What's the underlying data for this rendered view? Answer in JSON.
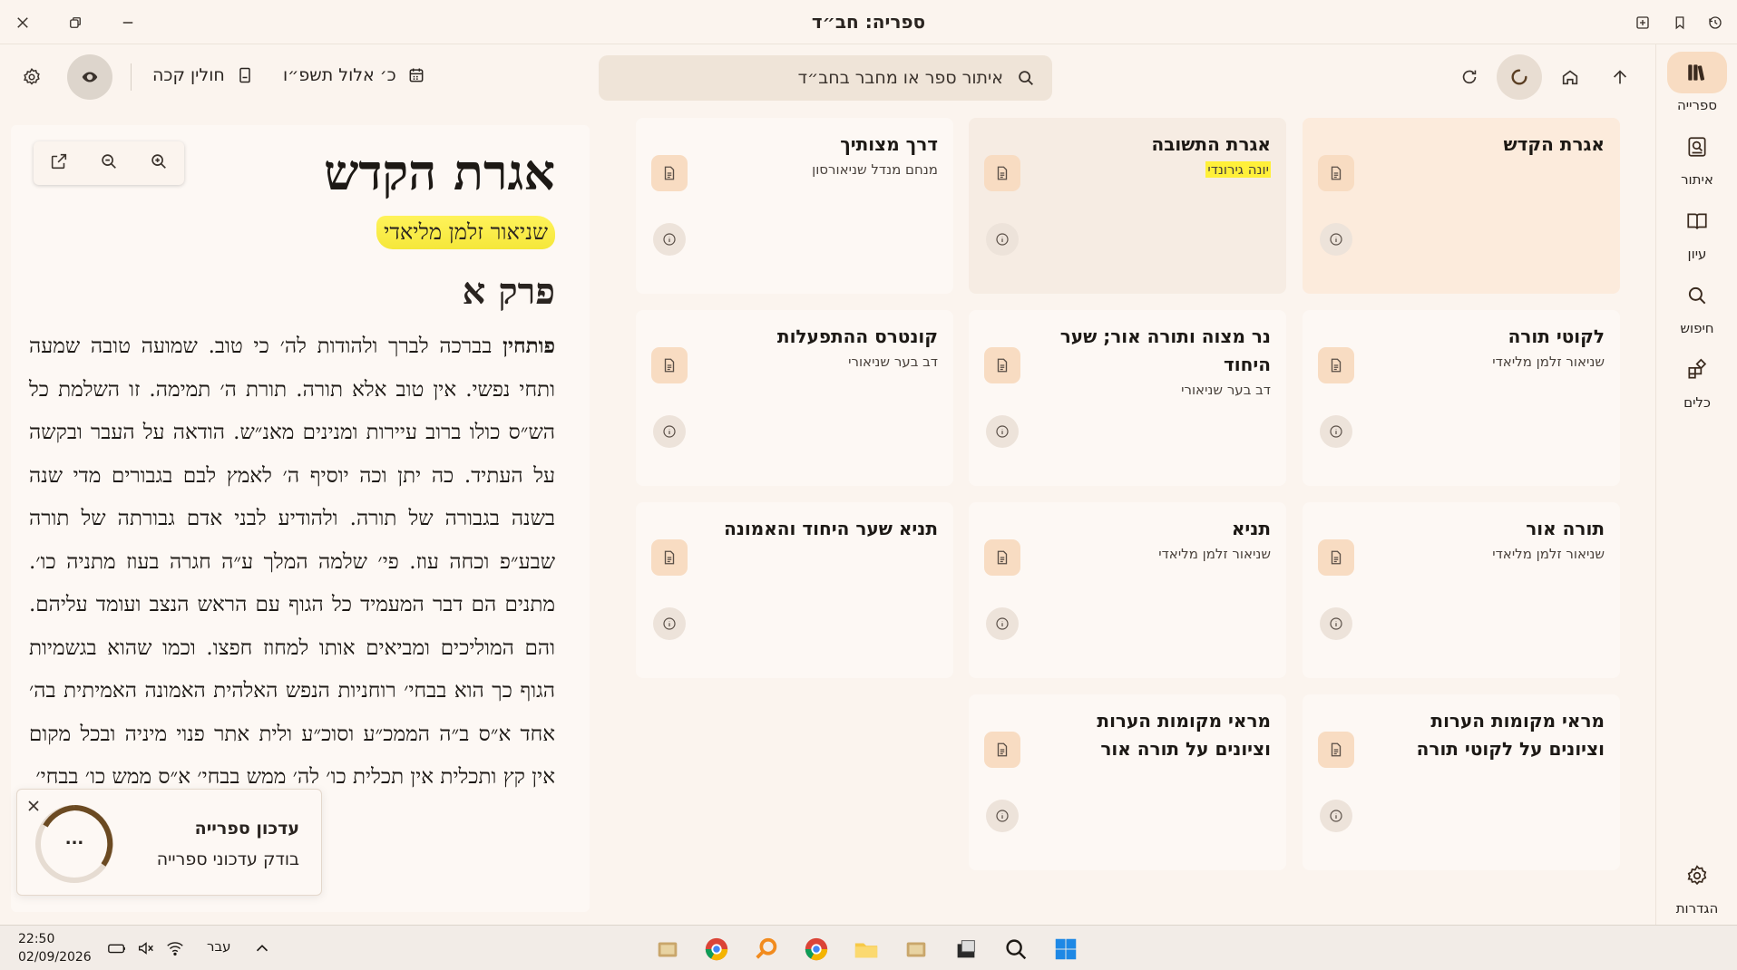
{
  "window": {
    "title": "ספריה: חב״ד"
  },
  "toolbar": {
    "search_placeholder": "איתור ספר או מחבר בחב״ד",
    "date_label": "כ׳ אלול תשפ״ו",
    "book_label": "חולין קכה"
  },
  "rail": {
    "items": [
      {
        "label": "ספרייה",
        "icon": "library-icon"
      },
      {
        "label": "איתור",
        "icon": "find-book-icon"
      },
      {
        "label": "עיון",
        "icon": "open-book-icon"
      },
      {
        "label": "חיפוש",
        "icon": "search-icon"
      },
      {
        "label": "כלים",
        "icon": "tools-icon"
      }
    ],
    "settings_label": "הגדרות"
  },
  "reader": {
    "title": "אגרת הקדש",
    "author": "שניאור זלמן מליאדי",
    "chapter": "פרק א",
    "first_word": "פותחין",
    "body": "בברכה לברך ולהודות לה׳ כי טוב. שמועה טובה שמעה ותחי נפשי. אין טוב אלא תורה. תורת ה׳ תמימה. זו השלמת כל הש״ס כולו ברוב עיירות ומנינים מאנ״ש. הודאה על העבר ובקשה על העתיד. כה יתן וכה יוסיף ה׳ לאמץ לבם בגבורים מדי שנה בשנה בגבורה של תורה. ולהודיע לבני אדם גבורתה של תורה שבע״פ וכחה עוז. פי׳ שלמה המלך ע״ה חגרה בעוז מתניה כו׳. מתנים הם דבר המעמיד כל הגוף עם הראש הנצב ועומד עליהם. והם המוליכים ומביאים אותו למחוז חפצו. וכמו שהוא בגשמיות הגוף כך הוא בבחי׳ רוחניות הנפש האלהית האמונה האמיתית בה׳ אחד א״ס ב״ה הממכ״ע וסוכ״ע ולית אתר פנוי מיניה ובכל מקום אין קץ ותכלית אין תכלית כו׳ לה׳ ממש בבחי׳ א״ס ממש כו׳ בבחי׳"
  },
  "toast": {
    "title": "עדכון ספרייה",
    "subtitle": "בודק עדכוני ספרייה",
    "ring_label": "..."
  },
  "cards": [
    {
      "title": "אגרת הקדש",
      "author": "",
      "state": "selected"
    },
    {
      "title": "אגרת התשובה",
      "author": "יונה גירונדי",
      "state": "hover",
      "author_highlighted": true
    },
    {
      "title": "דרך מצותיך",
      "author": "מנחם מנדל שניאורסון",
      "state": "normal"
    },
    {
      "title": "לקוטי תורה",
      "author": "שניאור זלמן מליאדי",
      "state": "normal"
    },
    {
      "title": "נר מצוה ותורה אור; שער היחוד",
      "author": "דב בער שניאורי",
      "state": "normal"
    },
    {
      "title": "קונטרס ההתפעלות",
      "author": "דב בער שניאורי",
      "state": "normal"
    },
    {
      "title": "תורה אור",
      "author": "שניאור זלמן מליאדי",
      "state": "normal"
    },
    {
      "title": "תניא",
      "author": "שניאור זלמן מליאדי",
      "state": "normal"
    },
    {
      "title": "תניא שער היחוד והאמונה",
      "author": "",
      "state": "normal"
    },
    {
      "title": "מראי מקומות הערות וציונים על לקוטי תורה",
      "author": "",
      "state": "normal"
    },
    {
      "title": "מראי מקומות הערות וציונים על תורה אור",
      "author": "",
      "state": "normal"
    }
  ],
  "taskbar": {
    "time": "22:50",
    "date": "02/09/2026",
    "language": "עבר"
  },
  "colors": {
    "background": "#fbf4ee",
    "accent": "#f8dcc2",
    "highlight": "#fff03a",
    "selected_card": "#fcebdc"
  }
}
